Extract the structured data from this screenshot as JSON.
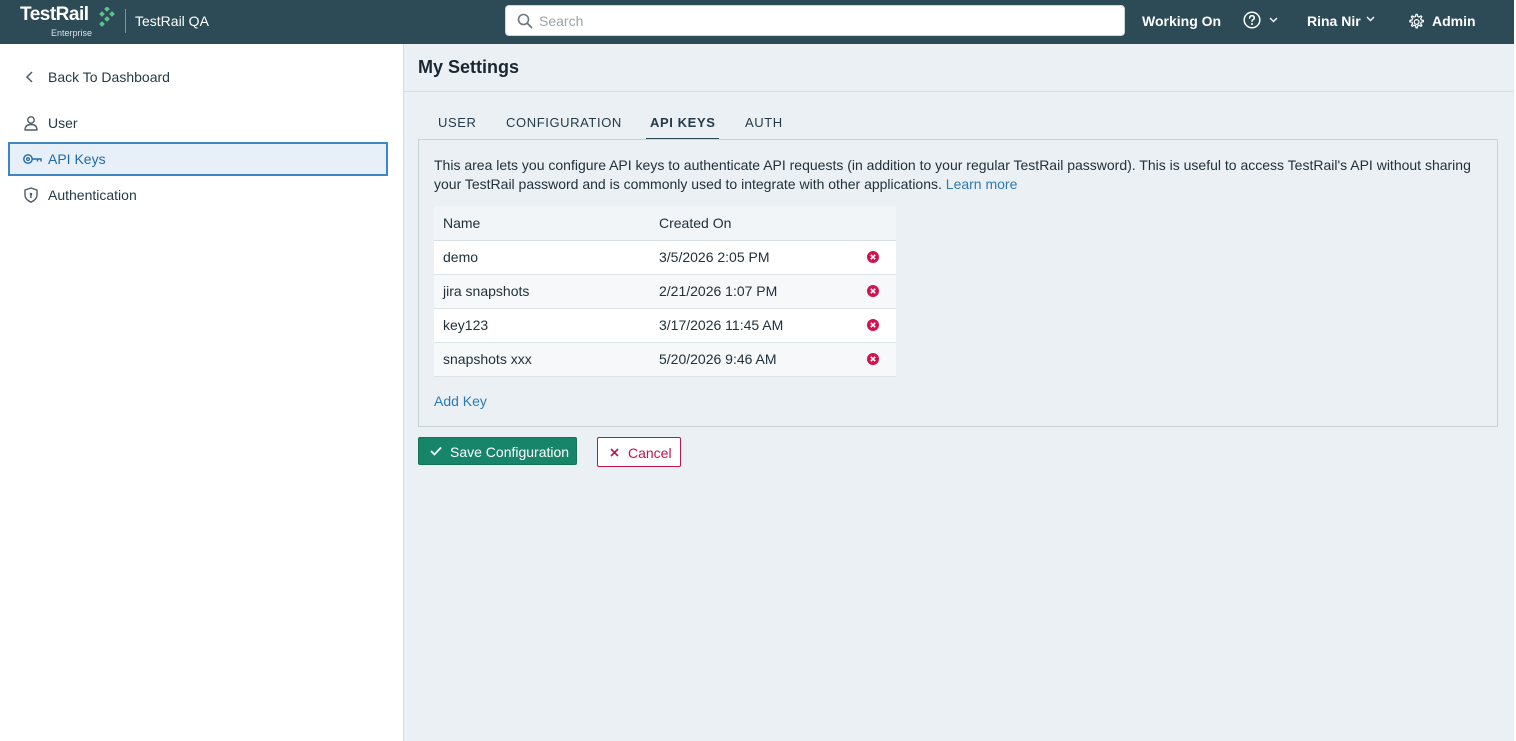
{
  "header": {
    "logo_text": "TestRail",
    "logo_subtitle": "Enterprise",
    "project_name": "TestRail QA",
    "search_placeholder": "Search",
    "working_on": "Working On",
    "user_name": "Rina Nir",
    "admin_label": "Admin",
    "bg_color": "#2c4b57",
    "icons": [
      "search-icon",
      "help-icon",
      "chevron-down-icon",
      "gear-icon"
    ]
  },
  "sidebar": {
    "back_label": "Back To Dashboard",
    "items": [
      {
        "label": "User",
        "icon": "user-icon",
        "active": false
      },
      {
        "label": "API Keys",
        "icon": "key-icon",
        "active": true
      },
      {
        "label": "Authentication",
        "icon": "shield-icon",
        "active": false
      }
    ]
  },
  "main": {
    "title": "My Settings",
    "tabs": [
      {
        "label": "USER",
        "active": false
      },
      {
        "label": "CONFIGURATION",
        "active": false
      },
      {
        "label": "API KEYS",
        "active": true
      },
      {
        "label": "AUTH",
        "active": false
      }
    ],
    "description": "This area lets you configure API keys to authenticate API requests (in addition to your regular TestRail password). This is useful to access TestRail's API without sharing your TestRail password and is commonly used to integrate with other applications.",
    "learn_more": "Learn more",
    "table": {
      "columns": [
        "Name",
        "Created On"
      ],
      "rows": [
        {
          "name": "demo",
          "created_on": "3/5/2026 2:05 PM"
        },
        {
          "name": "jira snapshots",
          "created_on": "2/21/2026 1:07 PM"
        },
        {
          "name": "key123",
          "created_on": "3/17/2026 11:45 AM"
        },
        {
          "name": "snapshots xxx",
          "created_on": "5/20/2026 9:46 AM"
        }
      ]
    },
    "add_key": "Add Key",
    "save_label": "Save Configuration",
    "cancel_label": "Cancel",
    "colors": {
      "save": "#17856a",
      "cancel": "#c4124a",
      "link": "#2d7ab5",
      "delete": "#d1124f"
    }
  }
}
